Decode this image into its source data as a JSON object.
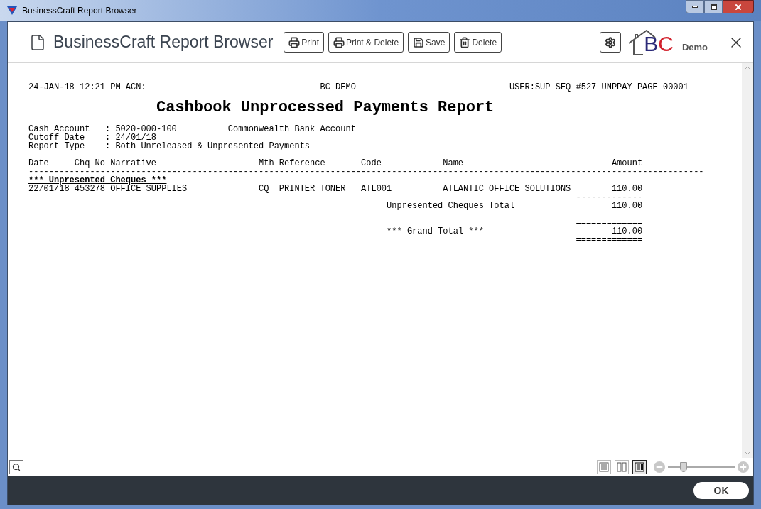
{
  "window": {
    "title": "BusinessCraft Report Browser"
  },
  "header": {
    "title": "BusinessCraft Report Browser",
    "buttons": [
      {
        "label": "Print",
        "kind": "print"
      },
      {
        "label": "Print & Delete",
        "kind": "print"
      },
      {
        "label": "Save",
        "kind": "save"
      },
      {
        "label": "Delete",
        "kind": "delete"
      }
    ],
    "logo": {
      "letters": [
        {
          "text": "B",
          "color": "#2b2a78"
        },
        {
          "text": "C",
          "color": "#d2232e"
        }
      ],
      "caption": "Demo"
    }
  },
  "report": {
    "top_line": {
      "left": "24-JAN-18 12:21 PM ACN:",
      "center": "BC DEMO",
      "right": "USER:SUP SEQ #527 UNPPAY PAGE 00001"
    },
    "title": "Cashbook Unprocessed Payments Report",
    "parameters": [
      {
        "label": "Cash Account",
        "separator": ":",
        "value": "5020-000-100",
        "extra": "Commonwealth Bank Account"
      },
      {
        "label": "Cutoff Date",
        "separator": ":",
        "value": "24/01/18"
      },
      {
        "label": "Report Type",
        "separator": ":",
        "value": "Both Unreleased & Unpresented Payments"
      }
    ],
    "columns": [
      "Date",
      "Chq No",
      "Narrative",
      "Mth",
      "Reference",
      "Code",
      "Name",
      "Amount"
    ],
    "header_rule": "------------------------------------------------------------------------------------------------------------------------------------",
    "section_heading": "*** Unpresented Cheques ***",
    "rows": [
      {
        "date": "22/01/18",
        "chq_no": "453278",
        "narrative": "OFFICE SUPPLIES",
        "mth": "CQ",
        "reference": "PRINTER TONER",
        "code": "ATL001",
        "name": "ATLANTIC OFFICE SOLUTIONS",
        "amount": "110.00"
      }
    ],
    "totals": [
      {
        "rule_above": "-------------",
        "label": "Unpresented Cheques Total",
        "amount": "110.00"
      },
      {
        "rule_above": "=============",
        "label": "*** Grand Total ***",
        "amount": "110.00",
        "rule_below": "============="
      }
    ]
  },
  "view_modes": [
    {
      "kind": "single",
      "selected": false
    },
    {
      "kind": "double",
      "selected": false
    },
    {
      "kind": "detail",
      "selected": true
    }
  ],
  "zoom": {
    "level": 0.23
  },
  "footer": {
    "ok_button": "OK"
  }
}
